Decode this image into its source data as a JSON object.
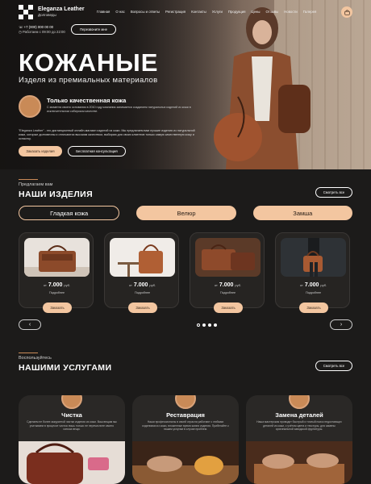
{
  "header": {
    "brand": "Eleganza Leather",
    "brand_sub": "Долговеды",
    "nav": [
      "Главная",
      "О нас",
      "Вопросы и ответы",
      "Регистрация",
      "Контакты",
      "Услуги",
      "Продукция",
      "Цены",
      "Отзывы",
      "Новости",
      "Галерея"
    ],
    "phone": "+7 (000) 000 00 00",
    "hours": "Работаем с 09:00 до 22:00",
    "callback_label": "Перезвоните мне"
  },
  "hero": {
    "title": "КОЖАНЫЕ",
    "subtitle": "Изделя из премиальных материалов",
    "quality_title": "Только качественная кожа",
    "quality_text": "С момента своего основания в 2010 году компания занимается созданием натуральных изделий из кожи в исключительном сибирском качестве.",
    "about_text": "\"Eleganza Leather\" - это дистанционный онлайн-магазин изделий из кожи. Мы предлагаем вам лучшие изделия из натуральной кожи, которые долговечны и отличаются высоким качеством, выбираю для своих клиентов только самую качественную кожу и оснастку.",
    "order_label": "Заказать изделия",
    "consult_label": "Бесплатная консультация"
  },
  "products": {
    "eyebrow": "Предлагаем вам",
    "title": "НАШИ ИЗДЕЛИЯ",
    "see_all": "Смотреть все",
    "tabs": [
      "Гладкая кожа",
      "Велюр",
      "Замша"
    ],
    "active_tab": 0,
    "price_prefix": "от",
    "currency": "руб.",
    "more_label": "Подробнее",
    "buy_label": "Заказать",
    "items": [
      {
        "price": "7.000"
      },
      {
        "price": "7.000"
      },
      {
        "price": "7.000"
      },
      {
        "price": "7.000"
      }
    ],
    "prev_icon": "‹",
    "next_icon": "›"
  },
  "services": {
    "eyebrow": "Воспользуйтесь",
    "title": "НАШИМИ УСЛУГАМИ",
    "see_all": "Смотреть все",
    "items": [
      {
        "title": "Чистка",
        "text": "Сделаем не более аккуратной чистки изделия из кожи. Ваш вещам мы учитываем в процессе чистки лишь только не перечислите своего износа вещи."
      },
      {
        "title": "Реставрация",
        "text": "Наши профессионалы в своей отрасли работают с любыми изделиями из кожи, вложенные время жизни изделия. Прибегайте к нашим услугам в случае проблем."
      },
      {
        "title": "Замена деталей",
        "text": "Наша мастерская проводит быстрый и точный поиск недостающих деталей из кожи, с учётом цвета и текстуры, для замены оригинальной заводской фурнитуры."
      }
    ]
  },
  "colors": {
    "accent": "#f3c6a0",
    "brown": "#c98a57",
    "bg": "#1c1b1a"
  }
}
